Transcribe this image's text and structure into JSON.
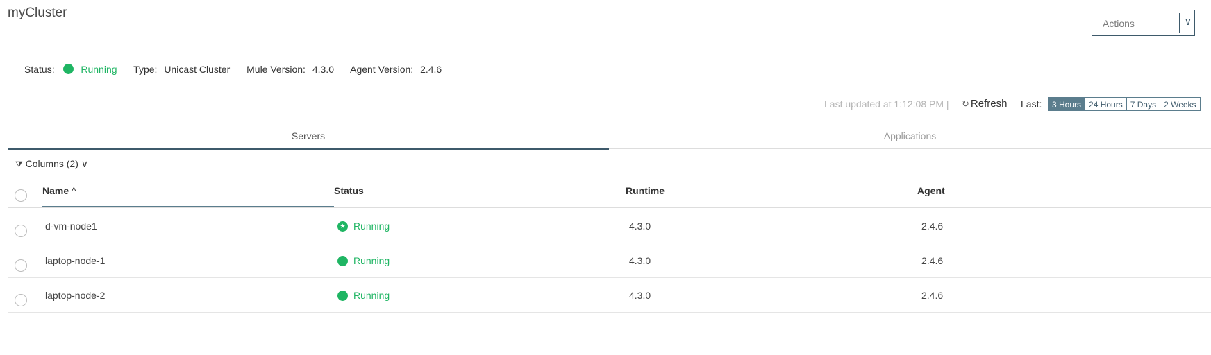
{
  "page": {
    "title": "myCluster"
  },
  "actions": {
    "label": "Actions"
  },
  "status_bar": {
    "status_label": "Status:",
    "status_value": "Running",
    "type_label": "Type:",
    "type_value": "Unicast Cluster",
    "mule_label": "Mule Version:",
    "mule_value": "4.3.0",
    "agent_label": "Agent Version:",
    "agent_value": "2.4.6"
  },
  "toolbar": {
    "last_updated": "Last updated at 1:12:08 PM  |",
    "refresh_label": "Refresh",
    "last_label": "Last:",
    "ranges": [
      "3 Hours",
      "24 Hours",
      "7 Days",
      "2 Weeks"
    ],
    "active_range": "3 Hours"
  },
  "tabs": [
    {
      "label": "Servers",
      "active": true
    },
    {
      "label": "Applications",
      "active": false
    }
  ],
  "columns_toggle": {
    "label": "Columns (2)"
  },
  "table": {
    "headers": {
      "name": "Name",
      "status": "Status",
      "runtime": "Runtime",
      "agent": "Agent"
    },
    "sort_indicator": "^",
    "rows": [
      {
        "name": "d-vm-node1",
        "status": "Running",
        "runtime": "4.3.0",
        "agent": "2.4.6",
        "primary": true
      },
      {
        "name": "laptop-node-1",
        "status": "Running",
        "runtime": "4.3.0",
        "agent": "2.4.6",
        "primary": false
      },
      {
        "name": "laptop-node-2",
        "status": "Running",
        "runtime": "4.3.0",
        "agent": "2.4.6",
        "primary": false
      }
    ]
  },
  "colors": {
    "running": "#1fb563",
    "accent": "#3e5a6b",
    "active_range_bg": "#5b7d8d"
  }
}
